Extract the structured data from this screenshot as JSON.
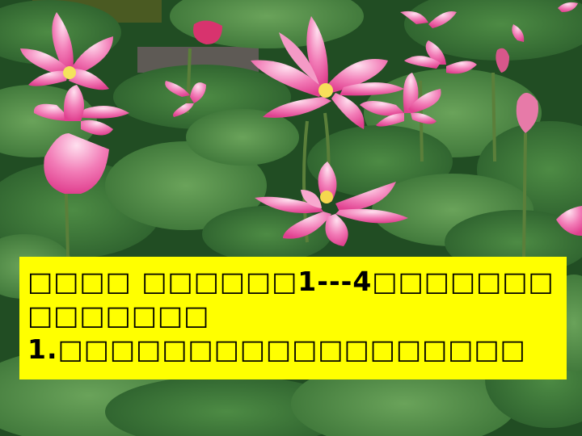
{
  "slide": {
    "background_image": "lotus-pond-photo",
    "text_box": {
      "background_color": "#ffff00",
      "lines": [
        "□□□□ □□□□□□1---4□□□□□□□",
        "□□□□□□□",
        "1.□□□□□□□□□□□□□□□□□□"
      ]
    }
  }
}
